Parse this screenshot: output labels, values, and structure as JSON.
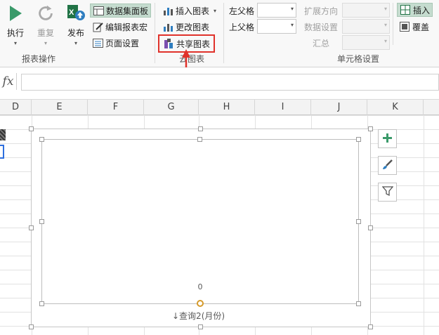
{
  "ribbon": {
    "report_ops": {
      "group_label": "报表操作",
      "execute_label": "执行",
      "redo_label": "重复",
      "publish_label": "发布",
      "dataset_panel_label": "数据集面板",
      "edit_macro_label": "编辑报表宏",
      "page_setup_label": "页面设置"
    },
    "cloud_chart": {
      "group_label": "云图表",
      "insert_chart_label": "插入图表",
      "change_chart_label": "更改图表",
      "share_chart_label": "共享图表"
    },
    "cell_settings": {
      "group_label": "单元格设置",
      "left_parent_label": "左父格",
      "up_parent_label": "上父格",
      "expand_direction_label": "扩展方向",
      "data_settings_label": "数据设置",
      "summary_label": "汇总",
      "insert_label": "插入",
      "overwrite_label": "覆盖"
    }
  },
  "formula_bar": {
    "fx_label": "fx",
    "value": ""
  },
  "columns": [
    "D",
    "E",
    "F",
    "G",
    "H",
    "I",
    "J",
    "K"
  ],
  "chart": {
    "axis_zero_label": "0",
    "axis_title": "↓查询2(月份)"
  },
  "colors": {
    "accent_green": "#217346",
    "highlight_red": "#e0322b",
    "active_bg": "#c5dccf"
  }
}
